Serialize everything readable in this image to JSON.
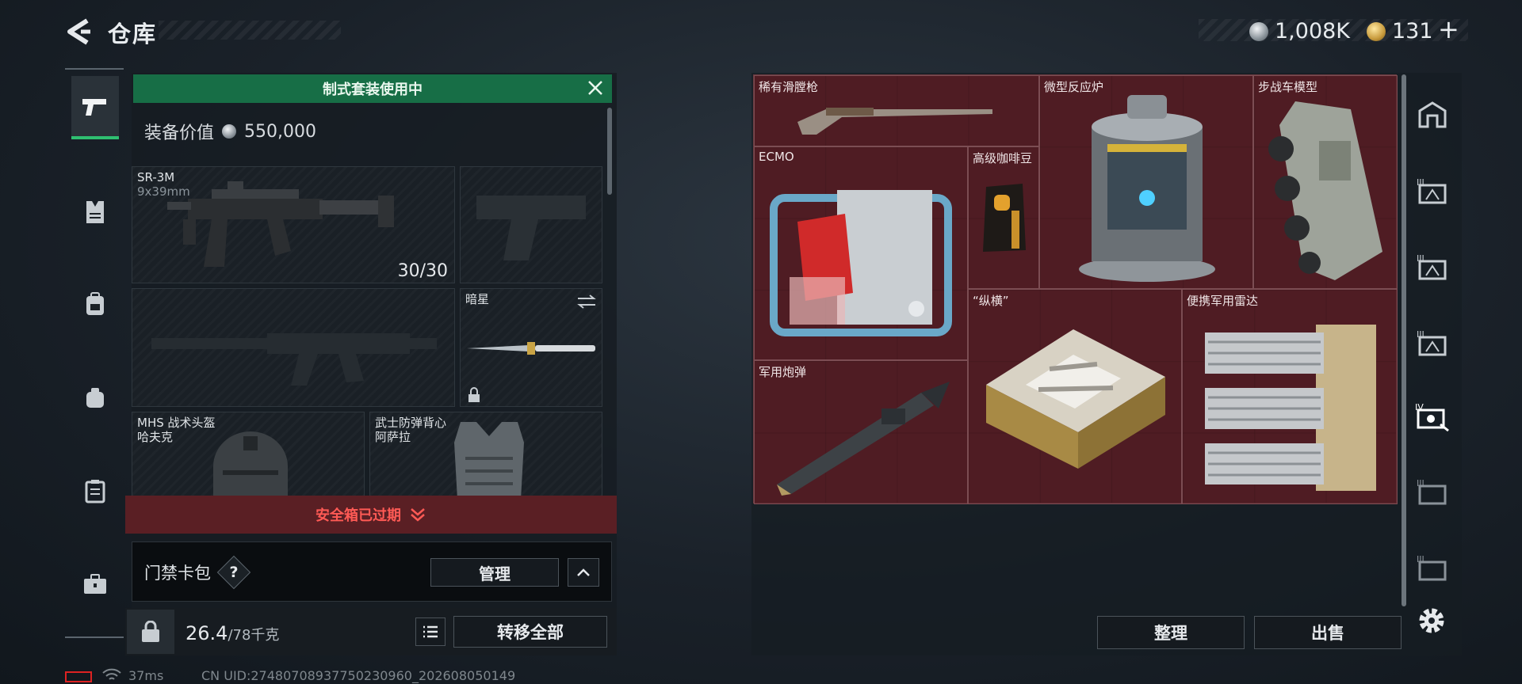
{
  "header": {
    "title": "仓库",
    "silver_amount": "1,008K",
    "gold_amount": "131",
    "plus_label": "+"
  },
  "left_nav": {
    "items": [
      {
        "name": "weapons",
        "icon": "pistol-icon",
        "active": true
      },
      {
        "name": "vest",
        "icon": "vest-icon",
        "active": false
      },
      {
        "name": "backpack",
        "icon": "backpack-icon",
        "active": false
      },
      {
        "name": "pouch",
        "icon": "pouch-icon",
        "active": false
      },
      {
        "name": "case",
        "icon": "case-icon",
        "active": false
      },
      {
        "name": "briefcase",
        "icon": "briefcase-icon",
        "active": false
      }
    ]
  },
  "loadout": {
    "banner": "制式套装使用中",
    "value_label": "装备价值",
    "value_amount": "550,000",
    "primary_weapon": {
      "name": "SR-3M",
      "caliber": "9x39mm",
      "ammo": "30/30"
    },
    "melee": {
      "name": "暗星"
    },
    "helmet": {
      "name": "MHS 战术头盔",
      "subtitle": "哈夫克"
    },
    "armor": {
      "name": "武士防弹背心",
      "subtitle": "阿萨拉"
    },
    "safe_box_status": "安全箱已过期",
    "keycard_label": "门禁卡包",
    "help_label": "?",
    "manage_label": "管理",
    "weight_current": "26.4",
    "weight_max": "/78千克",
    "transfer_all_label": "转移全部"
  },
  "stash": {
    "items": [
      {
        "label": "稀有滑膛枪"
      },
      {
        "label": "微型反应炉"
      },
      {
        "label": "步战车模型"
      },
      {
        "label": "ECMO"
      },
      {
        "label": "高级咖啡豆"
      },
      {
        "label": "“纵横”"
      },
      {
        "label": "便携军用雷达"
      },
      {
        "label": "军用炮弹"
      }
    ],
    "sort_label": "整理",
    "sell_label": "出售"
  },
  "right_nav": {
    "items": [
      {
        "icon": "safehouse-icon"
      },
      {
        "icon": "tier-3-storage-icon",
        "tier": "III"
      },
      {
        "icon": "tier-3-storage-icon",
        "tier": "III"
      },
      {
        "icon": "tier-3-storage-icon",
        "tier": "III"
      },
      {
        "icon": "tier-4-storage-icon",
        "tier": "IV"
      },
      {
        "icon": "tier-3-storage-icon",
        "tier": "III"
      },
      {
        "icon": "tier-3-storage-icon",
        "tier": "III"
      }
    ]
  },
  "status": {
    "ping": "37ms",
    "uid": "CN UID:27480708937750230960_202608050149"
  },
  "colors": {
    "active_green": "#2fbf71",
    "banner_green": "#176e46",
    "expired_red": "#ff5a55",
    "stash_red": "#4a1c22"
  }
}
